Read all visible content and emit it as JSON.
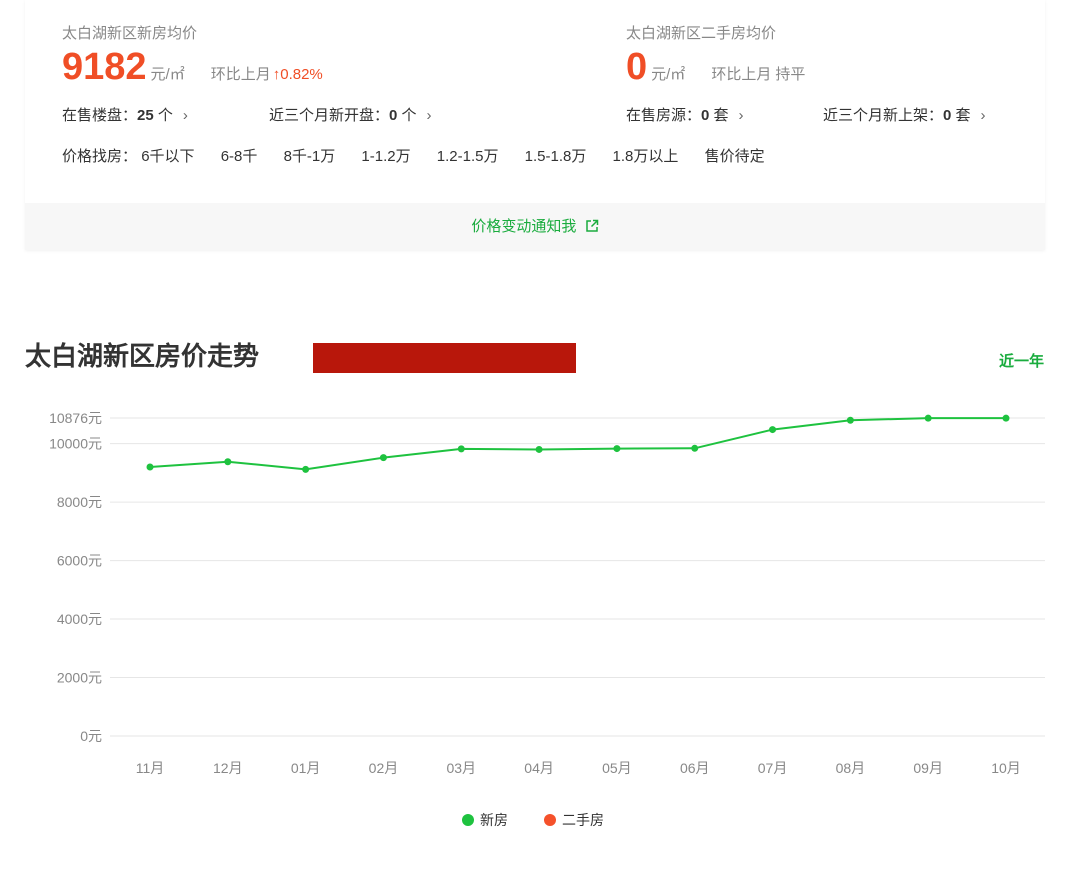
{
  "new_house": {
    "title": "太白湖新区新房均价",
    "price": "9182",
    "unit": "元/㎡",
    "mom_label": "环比上月",
    "mom_value": "↑0.82%",
    "on_sale_label": "在售楼盘：",
    "on_sale_count": "25",
    "on_sale_unit": "个",
    "recent_label": "近三个月新开盘：",
    "recent_count": "0",
    "recent_unit": "个"
  },
  "second_house": {
    "title": "太白湖新区二手房均价",
    "price": "0",
    "unit": "元/㎡",
    "mom_label": "环比上月",
    "mom_value": "持平",
    "on_sale_label": "在售房源：",
    "on_sale_count": "0",
    "on_sale_unit": "套",
    "recent_label": "近三个月新上架：",
    "recent_count": "0",
    "recent_unit": "套"
  },
  "price_filter": {
    "label": "价格找房：",
    "options": [
      "6千以下",
      "6-8千",
      "8千-1万",
      "1-1.2万",
      "1.2-1.5万",
      "1.5-1.8万",
      "1.8万以上",
      "售价待定"
    ]
  },
  "notify": {
    "label": "价格变动通知我"
  },
  "trend": {
    "title": "太白湖新区房价走势",
    "period": "近一年"
  },
  "colors": {
    "accent": "#f04e26",
    "green": "#1aac3e",
    "new_line": "#1ec23f",
    "second_dot": "#f5512b"
  },
  "chart_data": {
    "type": "line",
    "categories": [
      "11月",
      "12月",
      "01月",
      "02月",
      "03月",
      "04月",
      "05月",
      "06月",
      "07月",
      "08月",
      "09月",
      "10月"
    ],
    "series": [
      {
        "name": "新房",
        "values": [
          9200,
          9380,
          9120,
          9520,
          9820,
          9800,
          9830,
          9840,
          10480,
          10800,
          10870,
          10870
        ]
      },
      {
        "name": "二手房",
        "values": []
      }
    ],
    "yticks": [
      0,
      2000,
      4000,
      6000,
      8000,
      10000,
      10876
    ],
    "ytick_suffix": "元",
    "ylim": [
      0,
      10876
    ],
    "legend_position": "bottom-center"
  }
}
